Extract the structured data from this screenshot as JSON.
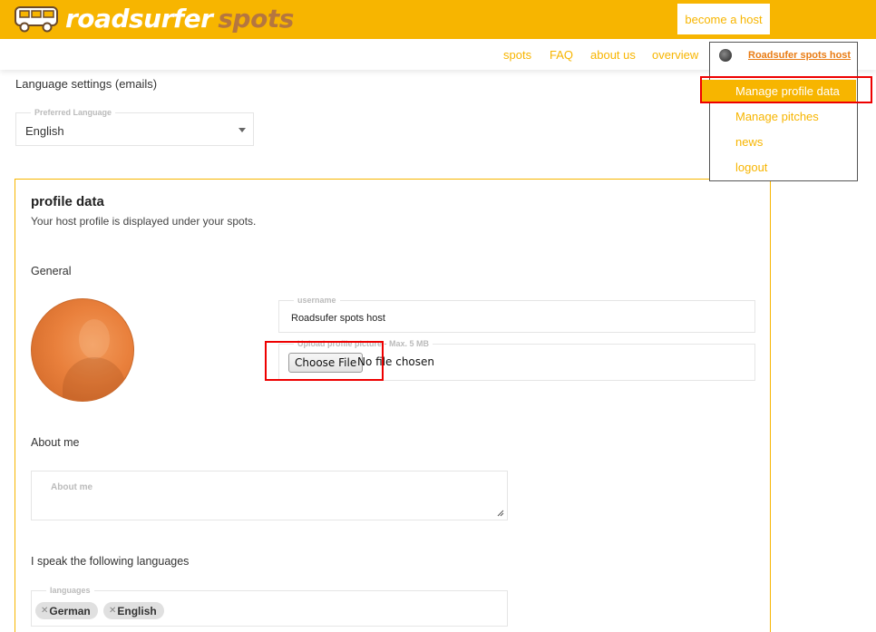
{
  "header": {
    "brand_part1": "roadsurfer",
    "brand_part2": "spots",
    "become_host": "become a host"
  },
  "nav": {
    "links": [
      "spots",
      "FAQ",
      "about us",
      "overview"
    ],
    "user_name": "Roadsufer spots host"
  },
  "user_menu": {
    "items": [
      "Manage profile data",
      "Manage pitches",
      "news",
      "logout"
    ],
    "active_index": 0
  },
  "language_settings": {
    "title": "Language settings (emails)",
    "legend": "Preferred Language",
    "value": "English"
  },
  "profile": {
    "title": "profile data",
    "subtitle": "Your host profile is displayed under your spots.",
    "general_label": "General",
    "username_legend": "username",
    "username_value": "Roadsufer spots host",
    "upload_legend": "Upload profile picture - Max. 5 MB",
    "choose_file": "Choose File",
    "no_file": "No file chosen",
    "about_label": "About me",
    "about_placeholder": "About me",
    "languages_label": "I speak the following languages",
    "languages_legend": "languages",
    "languages": [
      "German",
      "English"
    ]
  },
  "colors": {
    "brand_yellow": "#f7b500",
    "accent_orange": "#e97c14",
    "highlight_red": "#e00000"
  }
}
